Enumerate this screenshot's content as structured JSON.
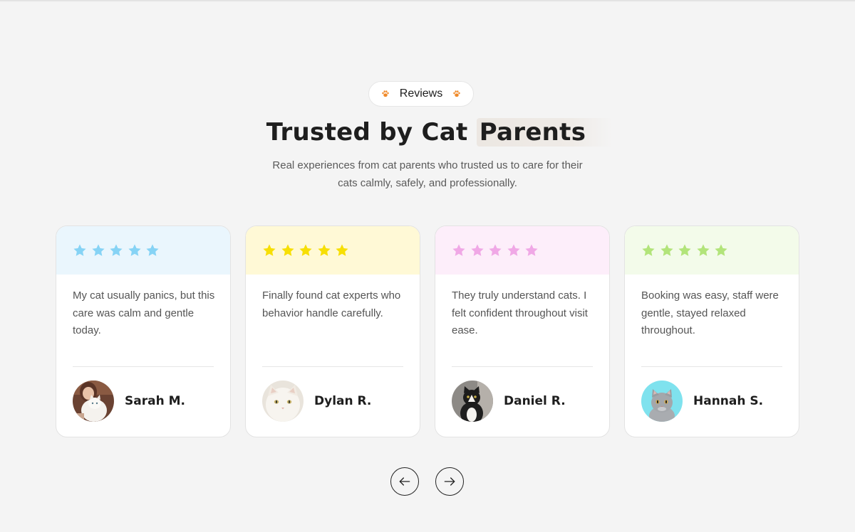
{
  "badge": {
    "label": "Reviews",
    "icon": "paw-icon",
    "icon_color": "#f08a2a"
  },
  "heading": {
    "title_main": "Trusted by Cat ",
    "title_highlight": "Parents"
  },
  "subtitle": "Real experiences from cat parents who trusted us  to care for their\ncats calmly, safely, and professionally.",
  "reviews": [
    {
      "rating": 5,
      "accent": "#eaf6fd",
      "star_color": "#86d3f5",
      "quote": "My cat usually panics, but this care was calm and gentle today.",
      "name": "Sarah M.",
      "avatar": "woman-holding-white-cat-avatar"
    },
    {
      "rating": 5,
      "accent": "#fff9d6",
      "star_color": "#f7df05",
      "quote": "Finally found cat experts who  behavior handle carefully.",
      "name": "Dylan R.",
      "avatar": "white-cat-avatar"
    },
    {
      "rating": 5,
      "accent": "#fdeefa",
      "star_color": "#f0a8e6",
      "quote": "They truly understand cats. I felt confident throughout visit  ease.",
      "name": "Daniel R.",
      "avatar": "tuxedo-cat-avatar"
    },
    {
      "rating": 5,
      "accent": "#f3fbea",
      "star_color": "#b2e47a",
      "quote": "Booking was easy, staff were gentle, stayed relaxed throughout.",
      "name": "Hannah S.",
      "avatar": "grey-cat-avatar"
    }
  ],
  "navigation": {
    "prev_icon": "arrow-left-icon",
    "next_icon": "arrow-right-icon"
  }
}
